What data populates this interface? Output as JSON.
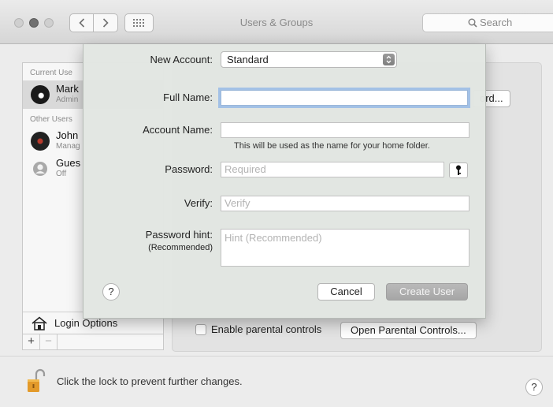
{
  "window": {
    "title": "Users & Groups"
  },
  "toolbar": {
    "search_placeholder": "Search"
  },
  "sidebar": {
    "current_users_label": "Current Use",
    "other_users_label": "Other Users",
    "users": [
      {
        "name": "Mark",
        "role": "Admin",
        "selected": true
      },
      {
        "name": "John",
        "role": "Manag",
        "selected": false
      },
      {
        "name": "Gues",
        "role": "Off",
        "selected": false
      }
    ],
    "login_options_label": "Login Options",
    "add_label": "+",
    "remove_label": "−"
  },
  "panel": {
    "change_password_label": "ord...",
    "parental_controls_label": "Enable parental controls",
    "open_parental_label": "Open Parental Controls..."
  },
  "footer": {
    "lock_text": "Click the lock to prevent further changes.",
    "help_label": "?"
  },
  "sheet": {
    "new_account_label": "New Account:",
    "new_account_value": "Standard",
    "full_name_label": "Full Name:",
    "full_name_value": "",
    "account_name_label": "Account Name:",
    "account_name_value": "",
    "account_name_note": "This will be used as the name for your home folder.",
    "password_label": "Password:",
    "password_placeholder": "Required",
    "verify_label": "Verify:",
    "verify_placeholder": "Verify",
    "hint_label": "Password hint:",
    "hint_sublabel": "(Recommended)",
    "hint_placeholder": "Hint (Recommended)",
    "help_label": "?",
    "cancel_label": "Cancel",
    "create_label": "Create User"
  }
}
